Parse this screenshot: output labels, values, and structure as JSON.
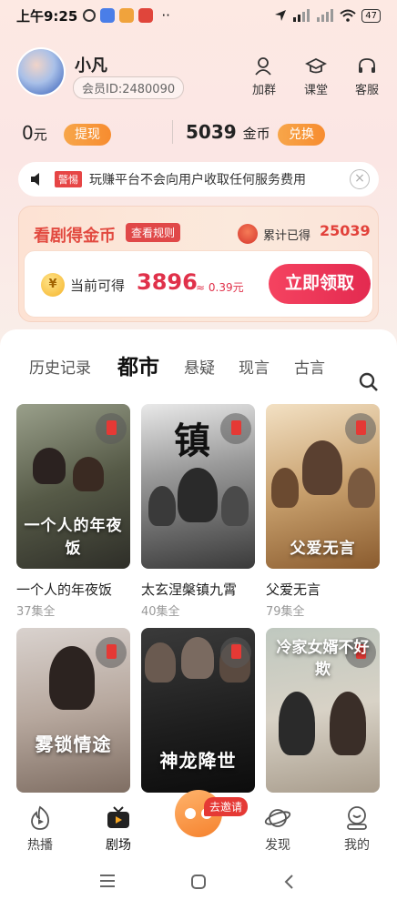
{
  "status_bar": {
    "time": "上午9:25",
    "dots": "··",
    "battery": "47"
  },
  "profile": {
    "name": "小凡",
    "member_id": "会员ID:2480090"
  },
  "top_actions": [
    {
      "label": "加群",
      "icon": "user-add-icon"
    },
    {
      "label": "课堂",
      "icon": "graduation-cap-icon"
    },
    {
      "label": "客服",
      "icon": "headset-icon"
    }
  ],
  "balance": {
    "cash_value": "0",
    "cash_unit": "元",
    "withdraw_label": "提现",
    "coins_value": "5039",
    "coins_unit": "金币",
    "exchange_label": "兑换"
  },
  "notice": {
    "tag": "警惕",
    "text": "玩赚平台不会向用户收取任何服务费用"
  },
  "reward": {
    "title": "看剧得金币",
    "rules_label": "查看规则",
    "cumulative_label": "累计已得",
    "cumulative_value": "25039",
    "available_label": "当前可得",
    "available_value": "3896",
    "approx_value": "≈ 0.39元",
    "coin_glyph": "¥",
    "claim_label": "立即领取"
  },
  "tabs": [
    {
      "label": "历史记录",
      "active": false
    },
    {
      "label": "都市",
      "active": true
    },
    {
      "label": "悬疑",
      "active": false
    },
    {
      "label": "现言",
      "active": false
    },
    {
      "label": "古言",
      "active": false
    }
  ],
  "dramas": [
    {
      "title": "一个人的年夜饭",
      "episodes": "37集全",
      "poster_text": "一个人的年夜饭"
    },
    {
      "title": "太玄涅槃镇九霄",
      "episodes": "40集全",
      "poster_text": "镇"
    },
    {
      "title": "父爱无言",
      "episodes": "79集全",
      "poster_text": "父爱无言"
    },
    {
      "title": "",
      "episodes": "",
      "poster_text": "雾锁情途"
    },
    {
      "title": "",
      "episodes": "",
      "poster_text": "神龙降世"
    },
    {
      "title": "",
      "episodes": "",
      "poster_text": "冷家女婿不好欺"
    }
  ],
  "bottom_nav": [
    {
      "label": "热播",
      "icon": "flame-play-icon"
    },
    {
      "label": "剧场",
      "icon": "tv-icon"
    },
    {
      "label": "发现",
      "icon": "planet-icon"
    },
    {
      "label": "我的",
      "icon": "profile-icon"
    }
  ],
  "invite": {
    "label": "去邀请"
  },
  "colors": {
    "accent_red": "#e2413a",
    "accent_orange": "#f78c2f",
    "claim_red": "#f54360"
  }
}
